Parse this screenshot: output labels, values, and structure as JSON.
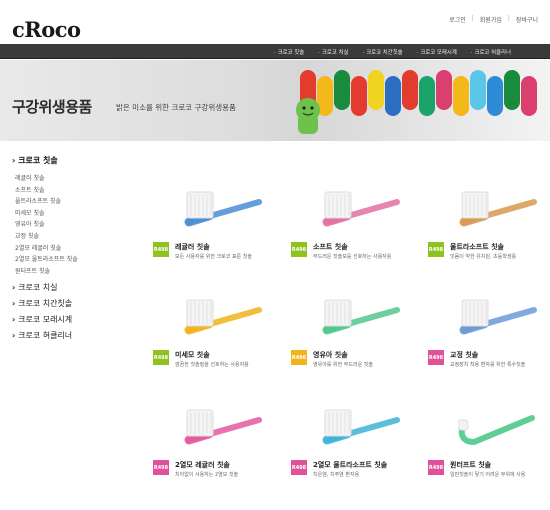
{
  "header": {
    "logo": "cRoco",
    "util": [
      "로그인",
      "회원가입",
      "장바구니"
    ]
  },
  "nav": [
    "크로코 칫솔",
    "크로코 치실",
    "크로코 치간칫솔",
    "크로코 모래시계",
    "크로코 혀클리너"
  ],
  "banner": {
    "title": "구강위생용품",
    "subtitle": "밝은 미소를 위한 크로코 구강위생용품"
  },
  "sidebar": {
    "title": "크로코 칫솔",
    "subs": [
      "레귤러 칫솔",
      "소프트 칫솔",
      "울트라소프트 칫솔",
      "미세모 칫솔",
      "영유아 칫솔",
      "교정 칫솔",
      "2열모 레귤러 칫솔",
      "2열모 울트라소프트 칫솔",
      "원터프트 칫솔"
    ],
    "cats": [
      "크로코 치실",
      "크로코 치간칫솔",
      "크로코 모래시계",
      "크로코 혀클리너"
    ]
  },
  "products": [
    {
      "badge": "R498",
      "name": "레귤러 칫솔",
      "desc": "모든 사용자를 위한 크로코 표준 칫솔",
      "badge_color": "#8dc21f",
      "handle_color": "#4a8fd4"
    },
    {
      "badge": "R498",
      "name": "소프트 칫솔",
      "desc": "부드러운 칫솔모를 선호하는 사용자용",
      "badge_color": "#8dc21f",
      "handle_color": "#e46fa4"
    },
    {
      "badge": "R498",
      "name": "울트라소프트 칫솔",
      "desc": "잇몸이 약한 유치원, 초등학생용",
      "badge_color": "#8dc21f",
      "handle_color": "#d99a52"
    },
    {
      "badge": "R498",
      "name": "미세모 칫솔",
      "desc": "깜끔한 칫솔질을 선호하는 사용자용",
      "badge_color": "#8dc21f",
      "handle_color": "#f0b41c"
    },
    {
      "badge": "R498",
      "name": "영유아 칫솔",
      "desc": "영유아를 위한 부드러운 칫솔",
      "badge_color": "#f3b21a",
      "handle_color": "#4fc88e"
    },
    {
      "badge": "R498",
      "name": "교정 칫솔",
      "desc": "교정장치 착용 환자를 위한 특수칫솔",
      "badge_color": "#e0519a",
      "handle_color": "#6a9cd8"
    },
    {
      "badge": "R498",
      "name": "2열모 레귤러 칫솔",
      "desc": "치아없이 사용하는 2열모 칫솔",
      "badge_color": "#e0519a",
      "handle_color": "#e65aa0"
    },
    {
      "badge": "R498",
      "name": "2열모 울트라소프트 칫솔",
      "desc": "치은염, 치주염 환자용",
      "badge_color": "#e0519a",
      "handle_color": "#3fb5d6"
    },
    {
      "badge": "R498",
      "name": "원터프트 칫솔",
      "desc": "일반칫솔이 닿기 어려운 부위에 사용",
      "badge_color": "#e0519a",
      "handle_color": "#37c27a"
    }
  ],
  "banner_brush_colors": [
    "#e33b2e",
    "#f5b81b",
    "#1a8a3c",
    "#e33b2e",
    "#f1d322",
    "#2b6fc2",
    "#e33b2e",
    "#1aa46a",
    "#d94070",
    "#f5b81b",
    "#5cc6e8",
    "#2e8bd8",
    "#1a8a3c",
    "#d94070"
  ]
}
